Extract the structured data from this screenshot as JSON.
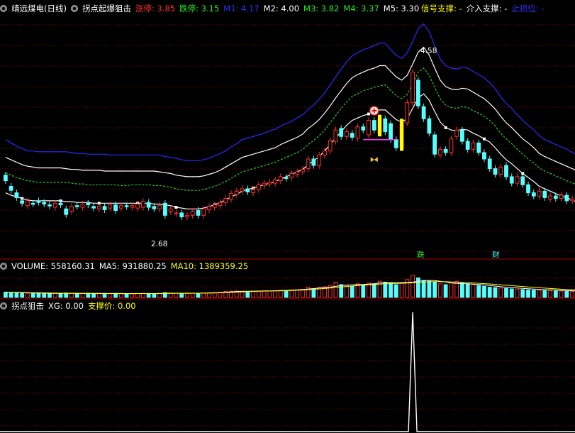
{
  "main_panel": {
    "title": "靖远煤电(日线)",
    "indicator": "拐点起爆狙击",
    "items": [
      {
        "label": "涨停: 3.85",
        "color": "#ff3030"
      },
      {
        "label": "跌停: 3.15",
        "color": "#22ee22"
      },
      {
        "label": "M1: 4.17",
        "color": "#3030ff"
      },
      {
        "label": "M2: 4.00",
        "color": "#ffffff"
      },
      {
        "label": "M3: 3.82",
        "color": "#22ee22"
      },
      {
        "label": "M4: 3.37",
        "color": "#22ee22"
      },
      {
        "label": "M5: 3.30",
        "color": "#ffffff"
      }
    ],
    "right_items": [
      {
        "label": "信号支撑: -",
        "color": "#ffff00"
      },
      {
        "label": "介入支撑: -",
        "color": "#ffffff"
      },
      {
        "label": "止损位: -",
        "color": "#3030ff"
      }
    ],
    "high_label": "4.58",
    "low_label": "2.68",
    "signal_fall": "跌",
    "signal_wealth": "财"
  },
  "volume_panel": {
    "title": "VOLUME: 558160.31",
    "ma5": "MA5: 931880.25",
    "ma10": "MA10: 1389359.25"
  },
  "signal_panel": {
    "title": "拐点狙击",
    "xg": "XG: 0.00",
    "support": "支撑价: 0.00"
  },
  "colors": {
    "up": "#ff3030",
    "down": "#54ffff",
    "band_outer": "#2a2aff",
    "band_inner": "#ffffff",
    "band_dash": "#22cc22",
    "grid": "#7a0000",
    "signal": "#ffff00"
  },
  "chart_data": {
    "type": "candlestick",
    "price_ylim": [
      2.3,
      5.3
    ],
    "high": 4.58,
    "low": 2.68,
    "candles": [
      {
        "o": 3.3,
        "c": 3.23
      },
      {
        "o": 3.16,
        "c": 3.11
      },
      {
        "o": 3.08,
        "c": 3.02
      },
      {
        "o": 2.98,
        "c": 2.95
      },
      {
        "o": 2.92,
        "c": 2.98
      },
      {
        "o": 2.95,
        "c": 2.94
      },
      {
        "o": 2.98,
        "c": 2.96
      },
      {
        "o": 2.96,
        "c": 2.94
      },
      {
        "o": 2.93,
        "c": 2.92
      },
      {
        "o": 2.9,
        "c": 2.95
      },
      {
        "o": 2.95,
        "c": 2.93
      },
      {
        "o": 2.88,
        "c": 2.81
      },
      {
        "o": 2.85,
        "c": 2.91
      },
      {
        "o": 2.92,
        "c": 2.91
      },
      {
        "o": 2.9,
        "c": 2.94
      },
      {
        "o": 2.95,
        "c": 2.93
      },
      {
        "o": 2.91,
        "c": 2.89
      },
      {
        "o": 2.88,
        "c": 2.91
      },
      {
        "o": 2.91,
        "c": 2.87
      },
      {
        "o": 2.89,
        "c": 2.93
      },
      {
        "o": 2.93,
        "c": 2.86
      },
      {
        "o": 2.89,
        "c": 2.92
      },
      {
        "o": 2.92,
        "c": 2.91
      },
      {
        "o": 2.9,
        "c": 2.92
      },
      {
        "o": 2.89,
        "c": 2.94
      },
      {
        "o": 2.9,
        "c": 2.97
      },
      {
        "o": 2.96,
        "c": 2.9
      },
      {
        "o": 2.91,
        "c": 2.88
      },
      {
        "o": 2.88,
        "c": 2.92
      },
      {
        "o": 2.95,
        "c": 2.8
      },
      {
        "o": 2.85,
        "c": 2.88
      },
      {
        "o": 2.82,
        "c": 2.83
      },
      {
        "o": 2.83,
        "c": 2.78
      },
      {
        "o": 2.78,
        "c": 2.8
      },
      {
        "o": 2.8,
        "c": 2.85
      },
      {
        "o": 2.86,
        "c": 2.8
      },
      {
        "o": 2.8,
        "c": 2.88
      },
      {
        "o": 2.87,
        "c": 2.91
      },
      {
        "o": 2.9,
        "c": 2.93
      },
      {
        "o": 2.92,
        "c": 2.96
      },
      {
        "o": 2.96,
        "c": 3.01
      },
      {
        "o": 3.0,
        "c": 3.07
      },
      {
        "o": 3.06,
        "c": 3.1
      },
      {
        "o": 3.1,
        "c": 3.13
      },
      {
        "o": 3.13,
        "c": 3.09
      },
      {
        "o": 3.08,
        "c": 3.12
      },
      {
        "o": 3.12,
        "c": 3.18
      },
      {
        "o": 3.17,
        "c": 3.2
      },
      {
        "o": 3.19,
        "c": 3.21
      },
      {
        "o": 3.2,
        "c": 3.24
      },
      {
        "o": 3.23,
        "c": 3.28
      },
      {
        "o": 3.27,
        "c": 3.26
      },
      {
        "o": 3.27,
        "c": 3.32
      },
      {
        "o": 3.31,
        "c": 3.34
      },
      {
        "o": 3.34,
        "c": 3.37
      },
      {
        "o": 3.38,
        "c": 3.5
      },
      {
        "o": 3.5,
        "c": 3.42
      },
      {
        "o": 3.42,
        "c": 3.55
      },
      {
        "o": 3.55,
        "c": 3.6
      },
      {
        "o": 3.6,
        "c": 3.73
      },
      {
        "o": 3.72,
        "c": 3.86
      },
      {
        "o": 3.88,
        "c": 3.78
      },
      {
        "o": 3.78,
        "c": 3.84
      },
      {
        "o": 3.82,
        "c": 3.77
      },
      {
        "o": 3.76,
        "c": 3.9
      },
      {
        "o": 3.9,
        "c": 3.86
      },
      {
        "o": 3.8,
        "c": 3.98
      },
      {
        "o": 3.98,
        "c": 3.86
      },
      {
        "o": 3.82,
        "c": 4.0
      },
      {
        "o": 4.0,
        "c": 3.84
      },
      {
        "o": 3.94,
        "c": 3.74
      },
      {
        "o": 3.74,
        "c": 3.64
      },
      {
        "o": 3.64,
        "c": 3.95
      },
      {
        "o": 3.95,
        "c": 4.2
      },
      {
        "o": 4.2,
        "c": 4.58
      },
      {
        "o": 4.48,
        "c": 4.16
      },
      {
        "o": 4.15,
        "c": 4.0
      },
      {
        "o": 4.0,
        "c": 3.82
      },
      {
        "o": 3.8,
        "c": 3.56
      },
      {
        "o": 3.55,
        "c": 3.62
      },
      {
        "o": 3.62,
        "c": 3.58
      },
      {
        "o": 3.58,
        "c": 3.75
      },
      {
        "o": 3.78,
        "c": 3.86
      },
      {
        "o": 3.86,
        "c": 3.72
      },
      {
        "o": 3.72,
        "c": 3.62
      },
      {
        "o": 3.62,
        "c": 3.7
      },
      {
        "o": 3.7,
        "c": 3.58
      },
      {
        "o": 3.58,
        "c": 3.5
      },
      {
        "o": 3.5,
        "c": 3.38
      },
      {
        "o": 3.38,
        "c": 3.31
      },
      {
        "o": 3.31,
        "c": 3.4
      },
      {
        "o": 3.42,
        "c": 3.28
      },
      {
        "o": 3.28,
        "c": 3.2
      },
      {
        "o": 3.2,
        "c": 3.28
      },
      {
        "o": 3.28,
        "c": 3.18
      },
      {
        "o": 3.18,
        "c": 3.08
      },
      {
        "o": 3.08,
        "c": 3.04
      },
      {
        "o": 3.04,
        "c": 3.1
      },
      {
        "o": 3.1,
        "c": 3.02
      },
      {
        "o": 3.0,
        "c": 3.04
      },
      {
        "o": 3.04,
        "c": 3.01
      },
      {
        "o": 3.01,
        "c": 3.05
      },
      {
        "o": 3.05,
        "c": 2.98
      },
      {
        "o": 2.98,
        "c": 3.0
      }
    ],
    "band_outer": [
      3.74,
      3.7,
      3.66,
      3.63,
      3.6,
      3.6,
      3.59,
      3.59,
      3.59,
      3.59,
      3.59,
      3.59,
      3.58,
      3.57,
      3.57,
      3.56,
      3.56,
      3.56,
      3.56,
      3.55,
      3.55,
      3.55,
      3.55,
      3.55,
      3.55,
      3.55,
      3.55,
      3.55,
      3.55,
      3.53,
      3.52,
      3.51,
      3.49,
      3.48,
      3.48,
      3.48,
      3.49,
      3.51,
      3.54,
      3.57,
      3.6,
      3.65,
      3.69,
      3.74,
      3.76,
      3.78,
      3.8,
      3.82,
      3.85,
      3.87,
      3.91,
      3.94,
      3.97,
      4.01,
      4.05,
      4.12,
      4.17,
      4.24,
      4.32,
      4.42,
      4.52,
      4.62,
      4.71,
      4.78,
      4.82,
      4.86,
      4.88,
      4.91,
      4.94,
      4.94,
      4.86,
      4.79,
      4.75,
      4.82,
      4.96,
      5.12,
      5.18,
      5.08,
      4.91,
      4.74,
      4.66,
      4.63,
      4.62,
      4.64,
      4.63,
      4.59,
      4.55,
      4.51,
      4.45,
      4.37,
      4.27,
      4.19,
      4.13,
      4.05,
      3.98,
      3.92,
      3.86,
      3.79,
      3.74,
      3.71,
      3.68,
      3.65,
      3.62,
      3.58,
      3.55,
      3.53
    ],
    "band_white": [
      3.52,
      3.49,
      3.46,
      3.43,
      3.41,
      3.4,
      3.39,
      3.39,
      3.39,
      3.39,
      3.39,
      3.38,
      3.37,
      3.37,
      3.36,
      3.36,
      3.36,
      3.36,
      3.35,
      3.35,
      3.35,
      3.35,
      3.35,
      3.35,
      3.35,
      3.35,
      3.35,
      3.35,
      3.34,
      3.33,
      3.32,
      3.3,
      3.29,
      3.28,
      3.28,
      3.28,
      3.29,
      3.31,
      3.33,
      3.36,
      3.4,
      3.44,
      3.48,
      3.52,
      3.54,
      3.56,
      3.58,
      3.6,
      3.62,
      3.64,
      3.68,
      3.71,
      3.74,
      3.77,
      3.81,
      3.88,
      3.93,
      3.99,
      4.07,
      4.16,
      4.26,
      4.35,
      4.44,
      4.51,
      4.55,
      4.58,
      4.61,
      4.63,
      4.66,
      4.66,
      4.59,
      4.52,
      4.48,
      4.54,
      4.68,
      4.83,
      4.89,
      4.79,
      4.63,
      4.48,
      4.4,
      4.37,
      4.36,
      4.38,
      4.37,
      4.33,
      4.29,
      4.25,
      4.19,
      4.12,
      4.03,
      3.95,
      3.89,
      3.82,
      3.75,
      3.7,
      3.64,
      3.57,
      3.53,
      3.5,
      3.47,
      3.44,
      3.41,
      3.38,
      3.35,
      3.33
    ],
    "band_dash": [
      3.33,
      3.3,
      3.27,
      3.25,
      3.23,
      3.22,
      3.21,
      3.21,
      3.21,
      3.21,
      3.21,
      3.21,
      3.2,
      3.19,
      3.19,
      3.18,
      3.18,
      3.18,
      3.18,
      3.18,
      3.18,
      3.17,
      3.17,
      3.18,
      3.18,
      3.18,
      3.18,
      3.17,
      3.17,
      3.16,
      3.15,
      3.13,
      3.12,
      3.11,
      3.11,
      3.11,
      3.12,
      3.14,
      3.16,
      3.19,
      3.22,
      3.26,
      3.3,
      3.34,
      3.36,
      3.38,
      3.4,
      3.42,
      3.44,
      3.46,
      3.49,
      3.52,
      3.55,
      3.58,
      3.62,
      3.68,
      3.73,
      3.79,
      3.86,
      3.95,
      4.04,
      4.13,
      4.21,
      4.28,
      4.31,
      4.35,
      4.37,
      4.39,
      4.41,
      4.42,
      4.35,
      4.29,
      4.25,
      4.3,
      4.44,
      4.58,
      4.63,
      4.54,
      4.39,
      4.25,
      4.17,
      4.14,
      4.13,
      4.15,
      4.14,
      4.1,
      4.07,
      4.03,
      3.98,
      3.91,
      3.82,
      3.75,
      3.69,
      3.62,
      3.56,
      3.5,
      3.45,
      3.39,
      3.35,
      3.32,
      3.29,
      3.26,
      3.23,
      3.2,
      3.18,
      3.16
    ],
    "band_lower": [
      3.08,
      3.05,
      3.03,
      3.01,
      2.99,
      2.98,
      2.98,
      2.98,
      2.98,
      2.98,
      2.98,
      2.97,
      2.97,
      2.96,
      2.96,
      2.96,
      2.95,
      2.95,
      2.95,
      2.95,
      2.95,
      2.95,
      2.95,
      2.95,
      2.95,
      2.95,
      2.95,
      2.94,
      2.94,
      2.93,
      2.92,
      2.9,
      2.89,
      2.88,
      2.88,
      2.88,
      2.89,
      2.91,
      2.93,
      2.96,
      2.99,
      3.03,
      3.06,
      3.1,
      3.12,
      3.14,
      3.16,
      3.18,
      3.2,
      3.22,
      3.25,
      3.28,
      3.31,
      3.34,
      3.37,
      3.43,
      3.48,
      3.53,
      3.6,
      3.68,
      3.76,
      3.84,
      3.92,
      3.98,
      4.01,
      4.04,
      4.06,
      4.08,
      4.11,
      4.11,
      4.05,
      3.99,
      3.96,
      4.0,
      4.13,
      4.26,
      4.31,
      4.23,
      4.09,
      3.96,
      3.89,
      3.86,
      3.85,
      3.87,
      3.86,
      3.82,
      3.79,
      3.75,
      3.71,
      3.64,
      3.56,
      3.49,
      3.44,
      3.38,
      3.32,
      3.27,
      3.22,
      3.16,
      3.13,
      3.1,
      3.07,
      3.04,
      3.02,
      2.99,
      2.96,
      2.94
    ],
    "volume_ylim": [
      0,
      3000000
    ],
    "volume": [
      620,
      560,
      540,
      500,
      480,
      520,
      510,
      470,
      450,
      480,
      470,
      520,
      500,
      480,
      470,
      490,
      460,
      450,
      470,
      440,
      480,
      450,
      430,
      440,
      460,
      480,
      470,
      450,
      460,
      560,
      520,
      500,
      470,
      460,
      490,
      480,
      520,
      560,
      580,
      620,
      700,
      740,
      760,
      730,
      690,
      700,
      750,
      780,
      760,
      800,
      850,
      820,
      880,
      900,
      960,
      1200,
      1000,
      1150,
      1250,
      1400,
      1800,
      1500,
      1400,
      1300,
      1600,
      1500,
      1700,
      1600,
      1900,
      1800,
      1700,
      1500,
      1700,
      2100,
      2600,
      2300,
      2000,
      1900,
      1800,
      1600,
      1500,
      1700,
      1900,
      1700,
      1600,
      1500,
      1400,
      1300,
      1200,
      1150,
      1100,
      1050,
      1000,
      950,
      920,
      880,
      850,
      830,
      800,
      780,
      760,
      740,
      720,
      700,
      680,
      660
    ],
    "ma5": [
      600,
      590,
      570,
      550,
      540,
      520,
      510,
      500,
      480,
      480,
      480,
      480,
      480,
      480,
      480,
      480,
      470,
      470,
      460,
      460,
      460,
      450,
      450,
      450,
      460,
      460,
      460,
      460,
      470,
      480,
      500,
      500,
      500,
      500,
      500,
      500,
      510,
      520,
      540,
      570,
      610,
      660,
      700,
      720,
      730,
      740,
      750,
      760,
      770,
      780,
      800,
      830,
      850,
      880,
      920,
      990,
      1040,
      1100,
      1160,
      1200,
      1300,
      1400,
      1450,
      1480,
      1500,
      1520,
      1560,
      1600,
      1680,
      1720,
      1740,
      1740,
      1740,
      1760,
      1800,
      1880,
      1960,
      2000,
      1980,
      1900,
      1800,
      1700,
      1650,
      1620,
      1600,
      1560,
      1520,
      1460,
      1400,
      1330,
      1260,
      1200,
      1150,
      1100,
      1060,
      1020,
      980,
      950,
      920,
      890,
      860,
      830,
      800,
      780,
      760,
      740
    ],
    "ma10": [
      620,
      600,
      590,
      580,
      560,
      550,
      540,
      530,
      520,
      510,
      500,
      500,
      490,
      490,
      480,
      480,
      480,
      480,
      470,
      470,
      470,
      465,
      460,
      460,
      460,
      460,
      460,
      460,
      460,
      470,
      480,
      485,
      490,
      490,
      495,
      500,
      505,
      510,
      520,
      540,
      560,
      590,
      620,
      650,
      680,
      700,
      720,
      740,
      750,
      760,
      780,
      800,
      820,
      840,
      870,
      910,
      950,
      1000,
      1050,
      1100,
      1160,
      1220,
      1280,
      1340,
      1400,
      1440,
      1480,
      1520,
      1560,
      1600,
      1620,
      1640,
      1660,
      1690,
      1720,
      1760,
      1800,
      1830,
      1850,
      1850,
      1840,
      1820,
      1800,
      1770,
      1740,
      1700,
      1660,
      1620,
      1580,
      1530,
      1480,
      1430,
      1380,
      1330,
      1280,
      1230,
      1180,
      1130,
      1090,
      1050,
      1010,
      970,
      940,
      910,
      880,
      860
    ],
    "signal_ylim": [
      0,
      1
    ],
    "signal_spike_index": 74,
    "signal_spike_value": 1
  }
}
